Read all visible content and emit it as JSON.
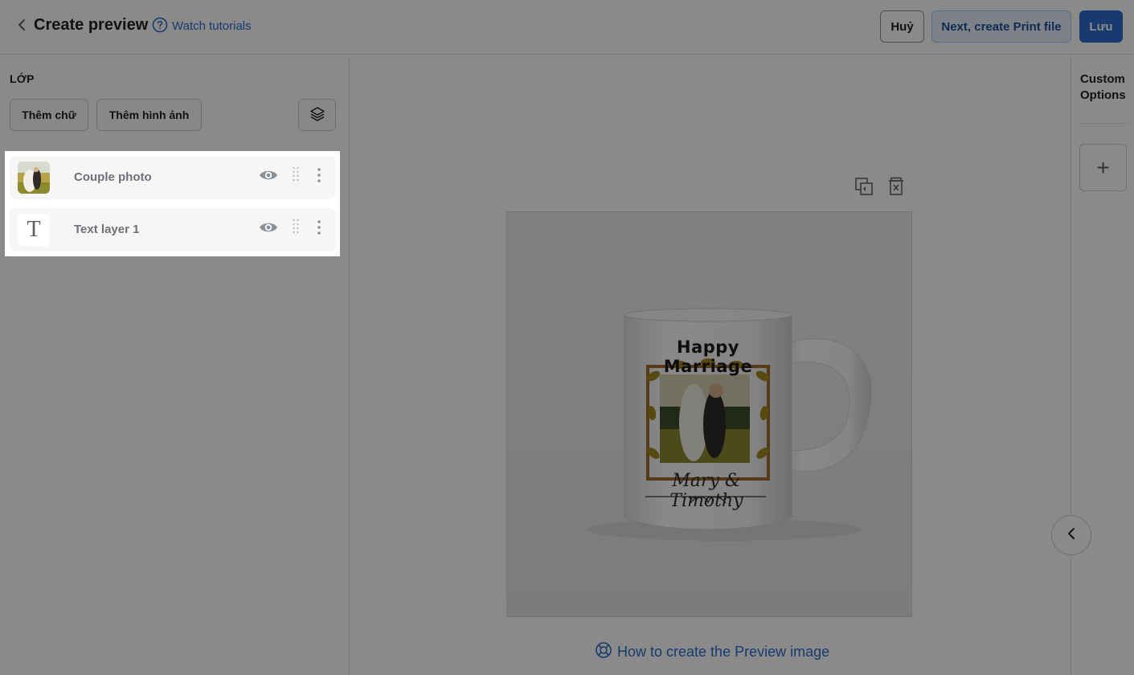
{
  "header": {
    "title": "Create preview",
    "tutorial_link": "Watch tutorials",
    "cancel_label": "Huỷ",
    "next_label": "Next, create Print file",
    "save_label": "Lưu"
  },
  "sidebar": {
    "heading": "LỚP",
    "add_text_label": "Thêm chữ",
    "add_image_label": "Thêm hình ảnh",
    "layers": [
      {
        "name": "Couple photo",
        "type": "image"
      },
      {
        "name": "Text layer 1",
        "type": "text",
        "thumb_glyph": "T"
      }
    ]
  },
  "canvas": {
    "mug_title": "Happy Marriage",
    "mug_names": "Mary & Timothy",
    "howto_link": "How to create the Preview image"
  },
  "right_panel": {
    "title": "Custom Options",
    "add_symbol": "+"
  },
  "colors": {
    "primary": "#2c6ecb",
    "overlay": "rgba(0,0,0,0.46)"
  },
  "icons": [
    "chevron-left-icon",
    "question-circle-icon",
    "layers-stack-icon",
    "eye-icon",
    "drag-handle-icon",
    "more-vertical-icon",
    "duplicate-icon",
    "delete-icon",
    "lifebuoy-icon",
    "plus-icon"
  ]
}
